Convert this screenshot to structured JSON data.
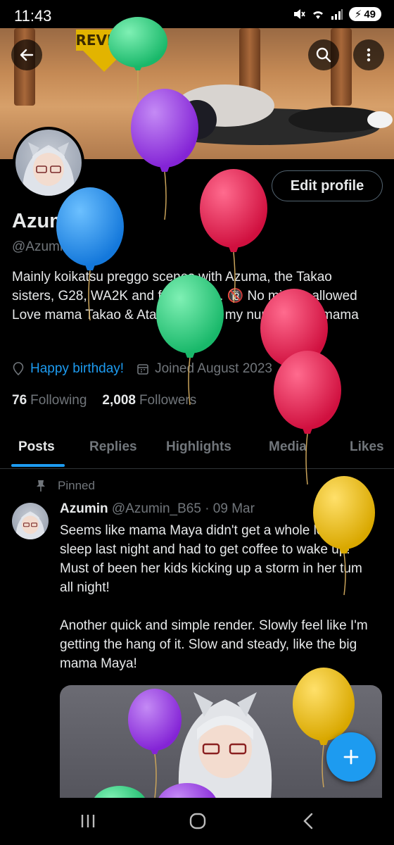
{
  "status": {
    "time": "11:43",
    "battery": "49"
  },
  "banner": {
    "sign_text": "REVIVE"
  },
  "profile": {
    "edit_label": "Edit profile",
    "name": "Azumin",
    "handle": "@Azumin_B65",
    "bio": "Mainly koikatsu preggo scenes with Azuma, the Takao sisters, G28, WA2K and few others. 🔞 No minors allowed  Love mama Takao & Atago  Maya is my number one mama",
    "birthday": "Happy birthday!",
    "joined": "Joined August 2023",
    "following_count": "76",
    "following_label": "Following",
    "followers_count": "2,008",
    "followers_label": "Followers"
  },
  "tabs": [
    "Posts",
    "Replies",
    "Highlights",
    "Media",
    "Likes"
  ],
  "post": {
    "pinned_label": "Pinned",
    "author": "Azumin",
    "handle": "@Azumin_B65",
    "date": "· 09 Mar",
    "text_1": "Seems like mama Maya didn't get a whole lot of sleep last night and had to get coffee to wake up! Must of been her kids kicking up a storm in her tum all night!",
    "text_2": "Another quick and simple render. Slowly feel like I'm getting the hang of it. Slow and steady, like the big mama Maya!"
  },
  "colors": {
    "accent": "#1d9bf0",
    "text": "#e7e9ea",
    "muted": "#71767b",
    "border": "#2f3336"
  },
  "icons": [
    "back-arrow-icon",
    "search-icon",
    "more-vertical-icon",
    "location-icon",
    "calendar-icon",
    "pin-icon",
    "plus-icon",
    "recents-icon",
    "home-icon",
    "back-icon"
  ]
}
